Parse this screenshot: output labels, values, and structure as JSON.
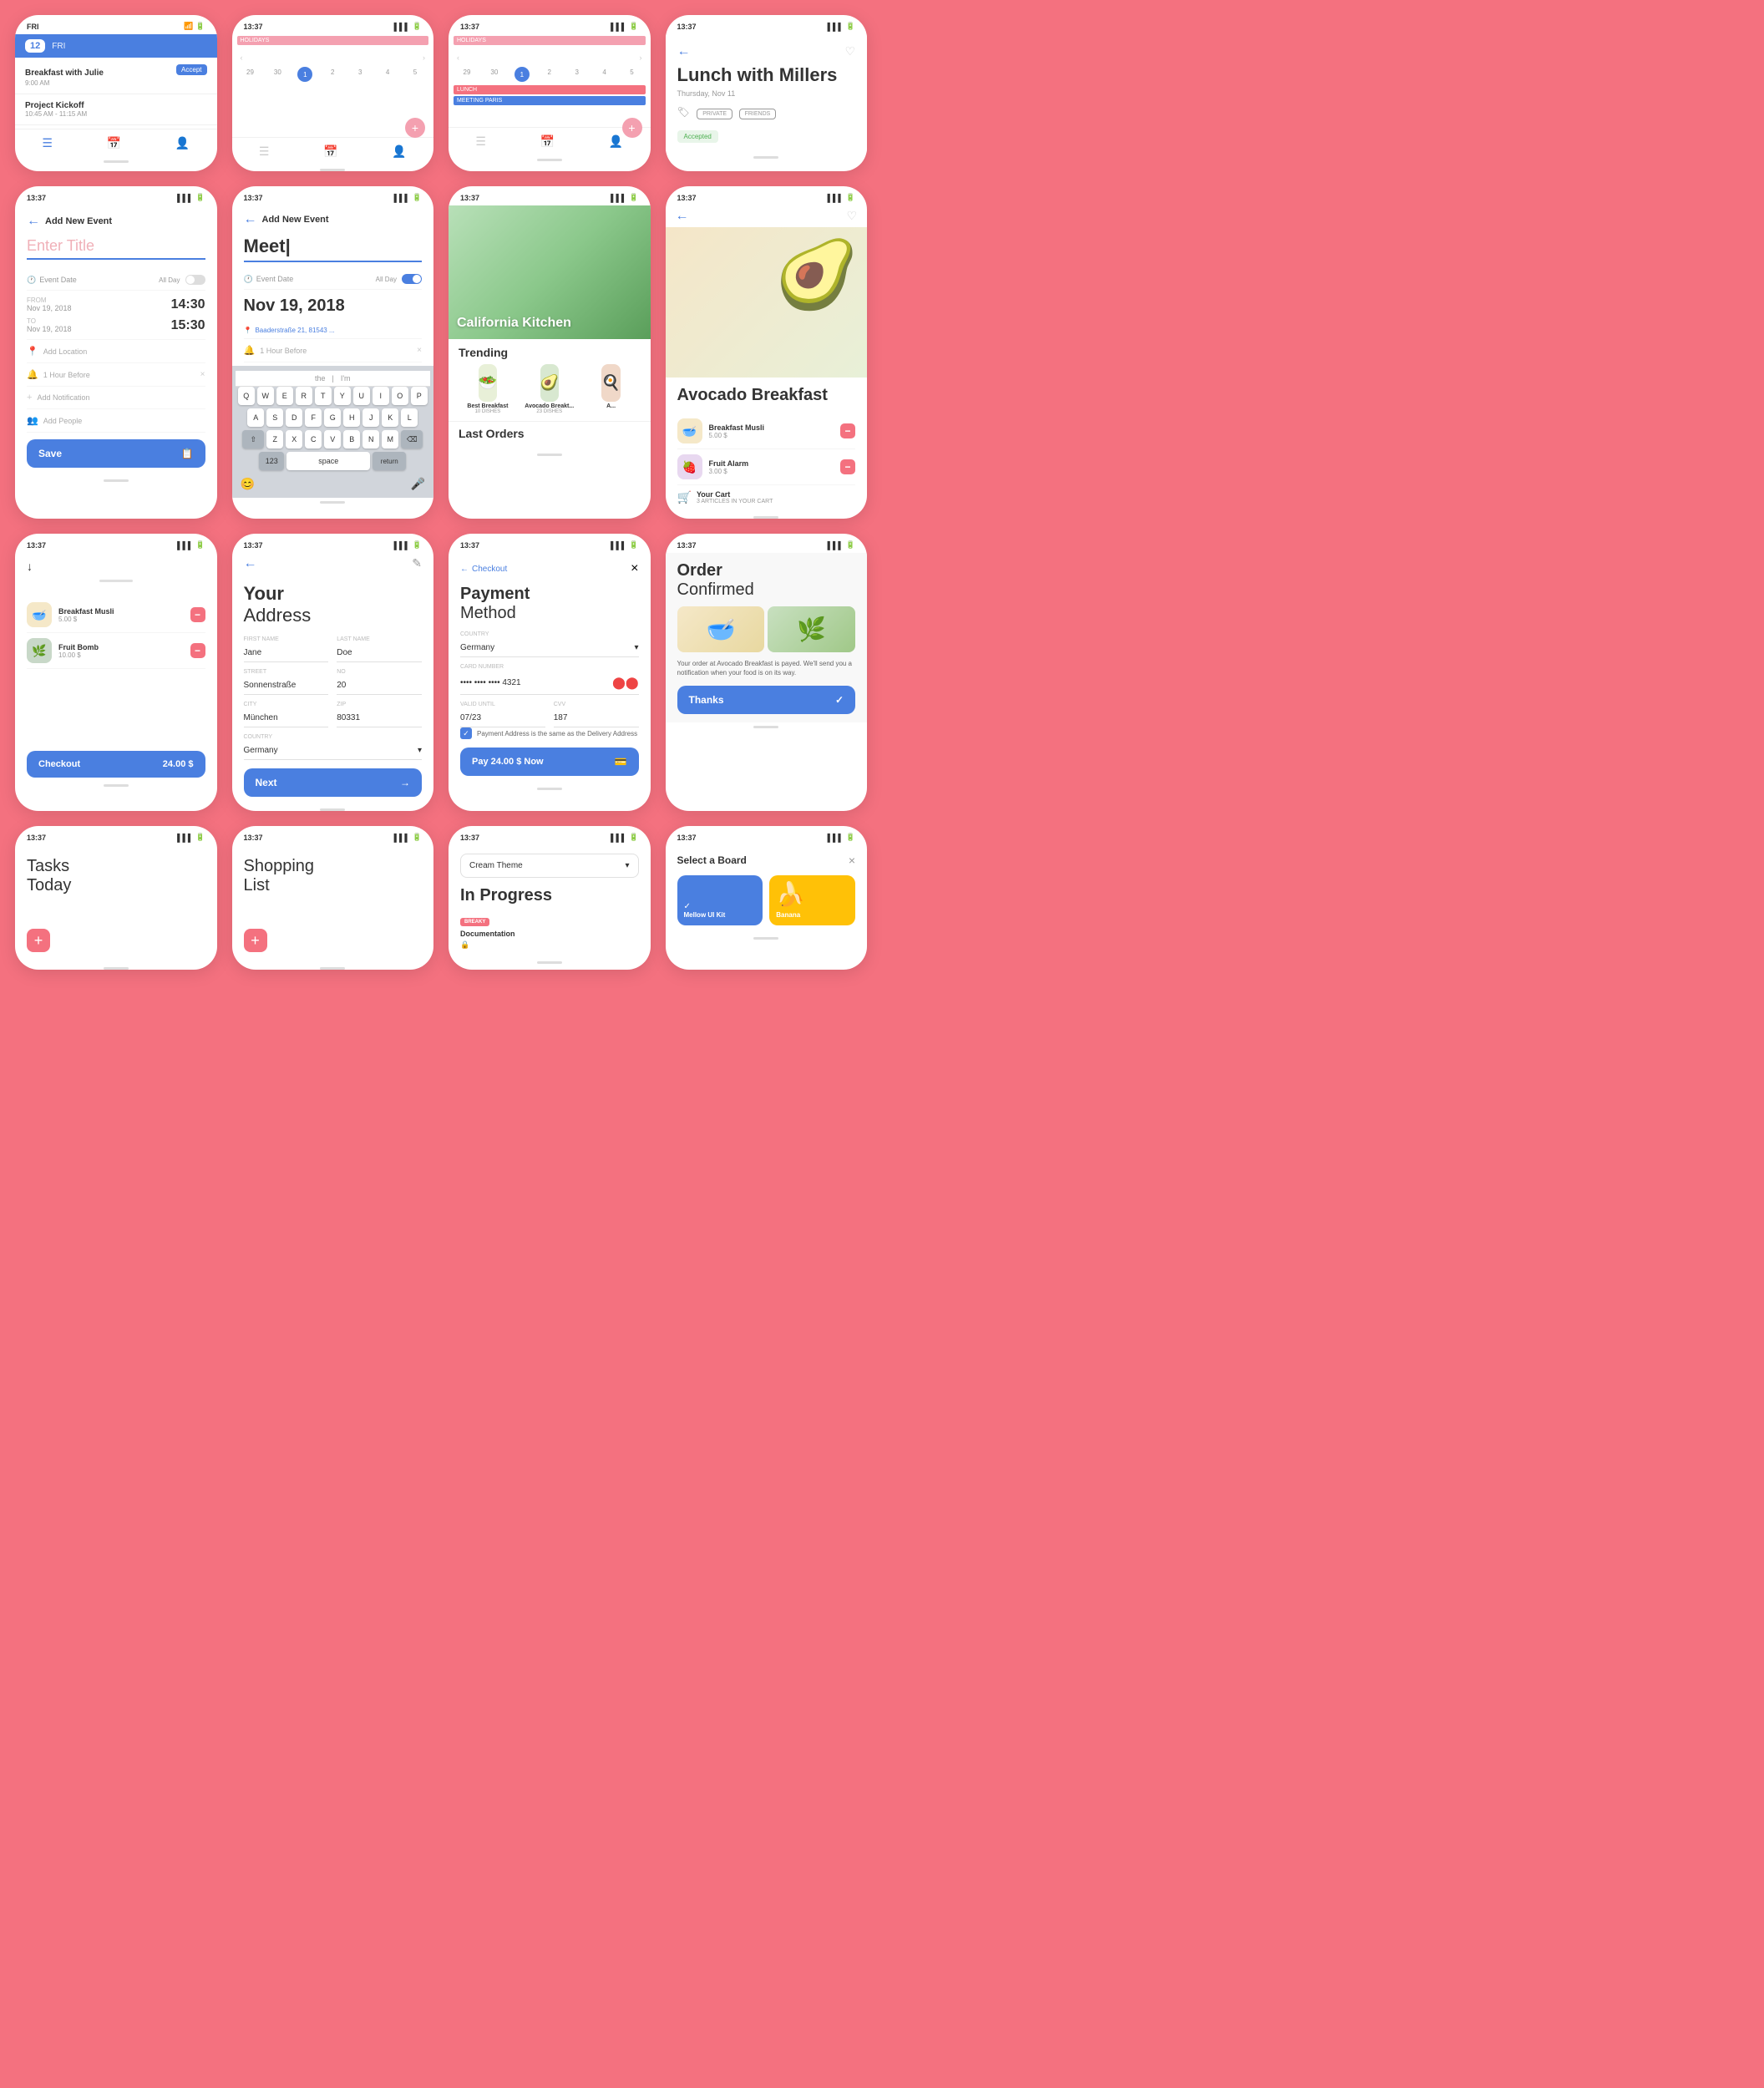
{
  "app": {
    "title": "Mellow UI Kit",
    "accent_color": "#4a7fe0",
    "bg_color": "#f4717f"
  },
  "row1": {
    "card1": {
      "date": "12",
      "day": "FRI",
      "events": [
        {
          "title": "Breakfast with Julie",
          "time": "9:00 AM",
          "action": "Accept"
        },
        {
          "title": "Project Kickoff",
          "time": "10:45 AM - 11:15 AM"
        }
      ],
      "nav_items": [
        "list",
        "calendar",
        "person"
      ]
    },
    "card2": {
      "status_time": "13:37",
      "type": "calendar_week",
      "holidays_label": "HOLIDAYS",
      "days": [
        "29",
        "30",
        "1",
        "2",
        "3",
        "4",
        "5"
      ]
    },
    "card3": {
      "status_time": "13:37",
      "type": "calendar_month",
      "holidays_label": "HOLIDAYS",
      "meeting_label": "MEETING PARIS",
      "lunch_label": "LUNCH"
    },
    "card4": {
      "status_time": "13:37",
      "type": "event_detail",
      "title": "Lunch with Millers",
      "date": "Thursday, Nov 11",
      "tags": [
        "PRIVATE",
        "FRIENDS"
      ],
      "status": "Accepted"
    }
  },
  "row2": {
    "card1": {
      "status_time": "13:37",
      "screen": "add_event",
      "title": "Add New Event",
      "placeholder": "Enter Title",
      "event_date_label": "Event Date",
      "all_day": "All Day",
      "from_label": "FROM",
      "to_label": "TO",
      "from_date": "Nov 19, 2018",
      "from_time": "14:30",
      "to_date": "Nov 19, 2018",
      "to_time": "15:30",
      "location_placeholder": "Add Location",
      "notification_label": "1 Hour Before",
      "add_notification_label": "Add Notification",
      "people_placeholder": "Add People",
      "save_label": "Save"
    },
    "card2": {
      "status_time": "13:37",
      "screen": "add_event_typing",
      "title": "Add New Event",
      "typed_text": "Meet|",
      "event_date_label": "Event Date",
      "all_day": "All Day",
      "date_value": "Nov 19, 2018",
      "location": "Baaderstraße 21, 81543 ...",
      "notification": "1 Hour Before",
      "keyboard_rows": [
        [
          "Q",
          "W",
          "E",
          "R",
          "T",
          "Y",
          "U",
          "I",
          "O",
          "P"
        ],
        [
          "A",
          "S",
          "D",
          "F",
          "G",
          "H",
          "J",
          "K",
          "L"
        ],
        [
          "⇧",
          "Z",
          "X",
          "C",
          "V",
          "B",
          "N",
          "M",
          "⌫"
        ],
        [
          "123",
          "space",
          "return"
        ]
      ]
    },
    "card3": {
      "status_time": "13:37",
      "screen": "food_trending",
      "food_category": "California Kitchen",
      "section_title": "Trending",
      "items": [
        {
          "name": "Best Breakfast",
          "count": "10 DISHES",
          "emoji": "🥗"
        },
        {
          "name": "Avocado Breakt...",
          "count": "23 DISHES",
          "emoji": "🥑"
        },
        {
          "name": "A...",
          "emoji": "🍳"
        }
      ],
      "last_orders_label": "Last Orders"
    },
    "card4": {
      "status_time": "13:37",
      "screen": "avocado_detail",
      "title": "Avocado Breakfast",
      "cart_items": [
        {
          "name": "Breakfast Musli",
          "price": "5.00 $",
          "emoji": "🥣"
        },
        {
          "name": "Fruit Alarm",
          "price": "3.00 $",
          "emoji": "🍓"
        }
      ],
      "your_cart_label": "Your Cart",
      "cart_sub": "3 ARTICLES IN YOUR CART"
    }
  },
  "row3": {
    "card1": {
      "status_time": "13:37",
      "screen": "cart",
      "items": [
        {
          "name": "Breakfast Musli",
          "price": "5.00 $",
          "emoji": "🥣"
        },
        {
          "name": "Fruit Bomb",
          "price": "10.00 $",
          "emoji": "🌿"
        }
      ],
      "checkout_label": "Checkout",
      "checkout_price": "24.00 $"
    },
    "card2": {
      "status_time": "13:37",
      "screen": "address",
      "title_bold": "Your",
      "title_light": "Address",
      "fields": [
        {
          "label": "FIRST NAME",
          "value": "Jane"
        },
        {
          "label": "LAST NAME",
          "value": "Doe"
        },
        {
          "label": "STREET",
          "value": "Sonnenstraße"
        },
        {
          "label": "NO",
          "value": "20"
        },
        {
          "label": "CITY",
          "value": "München"
        },
        {
          "label": "ZIP",
          "value": "80331"
        },
        {
          "label": "COUNTRY",
          "value": "Germany"
        }
      ],
      "next_label": "Next"
    },
    "card3": {
      "status_time": "13:37",
      "screen": "payment",
      "title": "Checkout",
      "payment_title_bold": "Payment",
      "payment_title_light": "Method",
      "country_label": "COUNTRY",
      "country_value": "Germany",
      "card_number_label": "CARD NUMBER",
      "card_number": "•••• •••• •••• 4321",
      "valid_label": "VALID UNTIL",
      "valid_value": "07/23",
      "cvv_label": "CVV",
      "cvv_value": "187",
      "checkbox_label": "Payment Address is the same as the Delivery Address",
      "pay_label": "Pay 24.00 $ Now"
    },
    "card4": {
      "status_time": "13:37",
      "screen": "order_confirmed",
      "title_bold": "Order",
      "title_light": "Confirmed",
      "order_text": "Your order at Avocado Breakfast is payed. We'll send you a notification when your food is on its way.",
      "thanks_label": "Thanks"
    }
  },
  "row4": {
    "card1": {
      "status_time": "13:37",
      "screen": "tasks",
      "title_line1": "Tasks",
      "title_line2": "Today"
    },
    "card2": {
      "status_time": "13:37",
      "screen": "shopping",
      "title_line1": "Shopping",
      "title_line2": "List"
    },
    "card3": {
      "status_time": "13:37",
      "screen": "in_progress",
      "theme_label": "Cream Theme",
      "section_title": "In Progress",
      "badge_label": "BREAKY",
      "item_label": "Documentation"
    },
    "card4": {
      "status_time": "13:37",
      "screen": "select_board",
      "title": "Select a Board",
      "boards": [
        {
          "label": "Mellow UI Kit",
          "selected": true,
          "emoji": ""
        },
        {
          "label": "Banana",
          "emoji": "🍌",
          "selected": false
        }
      ]
    }
  }
}
